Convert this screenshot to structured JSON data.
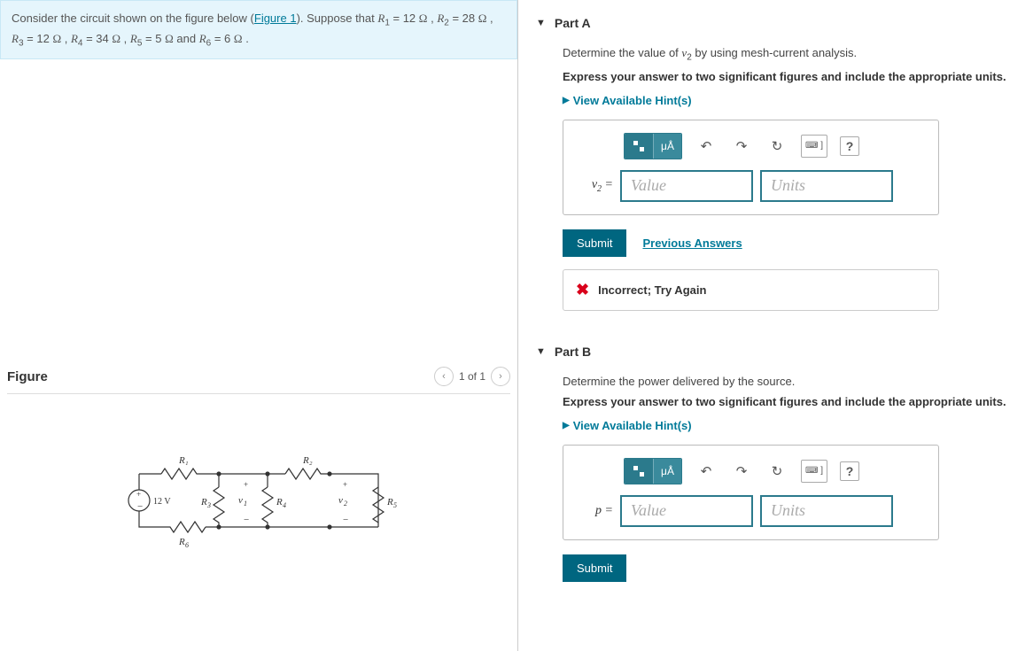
{
  "problem": {
    "prefix": "Consider the circuit shown on the figure below (",
    "figure_link": "Figure 1",
    "suffix": "). Suppose that ",
    "params_text": "R₁ = 12 Ω , R₂ = 28 Ω , R₃ = 12 Ω , R₄ = 34 Ω , R₅ = 5 Ω and R₆ = 6 Ω .",
    "R1": "12",
    "R2": "28",
    "R3": "12",
    "R4": "34",
    "R5": "5",
    "R6": "6",
    "unit": "Ω",
    "source_voltage": "12 V"
  },
  "figure": {
    "title": "Figure",
    "pager": "1 of 1",
    "labels": {
      "R1": "R₁",
      "R2": "R₂",
      "R3": "R₃",
      "R4": "R₄",
      "R5": "R₅",
      "R6": "R₆",
      "v1": "v₁",
      "v2": "v₂",
      "src": "12 V"
    }
  },
  "partA": {
    "title": "Part A",
    "prompt": "Determine the value of v₂ by using mesh-current analysis.",
    "instruction": "Express your answer to two significant figures and include the appropriate units.",
    "hints_label": "View Available Hint(s)",
    "lhs": "v₂ =",
    "value_placeholder": "Value",
    "units_placeholder": "Units",
    "submit": "Submit",
    "previous": "Previous Answers",
    "feedback": "Incorrect; Try Again"
  },
  "partB": {
    "title": "Part B",
    "prompt": "Determine the power delivered by the source.",
    "instruction": "Express your answer to two significant figures and include the appropriate units.",
    "hints_label": "View Available Hint(s)",
    "lhs": "p =",
    "value_placeholder": "Value",
    "units_placeholder": "Units",
    "submit": "Submit"
  },
  "toolbar": {
    "mu_a": "μÅ",
    "undo": "↶",
    "redo": "↷",
    "reset": "↻",
    "keyboard": "⌨",
    "help": "?"
  }
}
